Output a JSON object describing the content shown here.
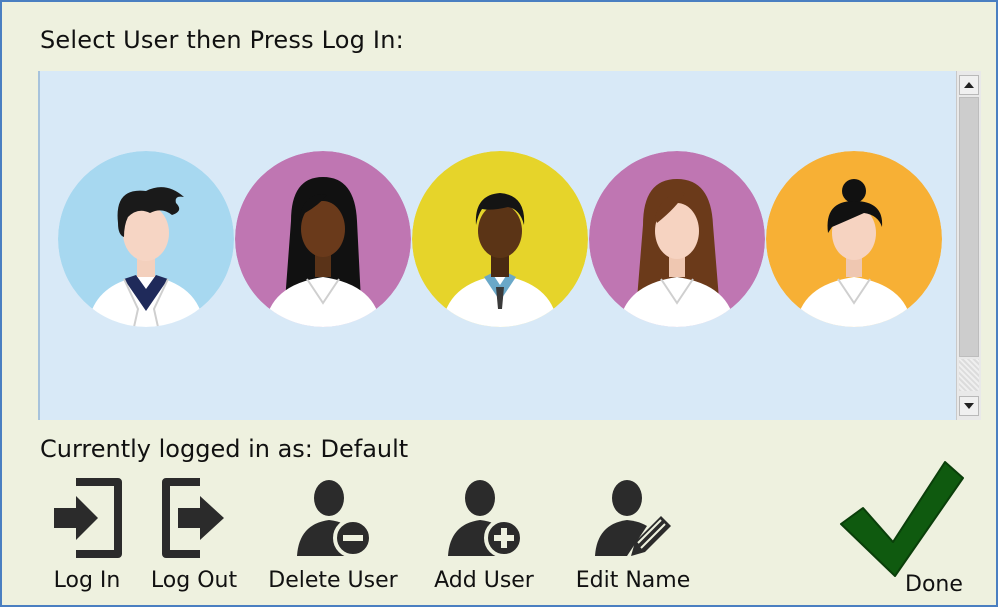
{
  "prompt": "Select User then Press Log In:",
  "status": "Currently logged in as: Default",
  "users": [
    {
      "icon": "male-doctor-avatar",
      "bg": "#a7d8f0"
    },
    {
      "icon": "female-doctor-avatar",
      "bg": "#bf76b2"
    },
    {
      "icon": "male-doctor-avatar",
      "bg": "#e6d42a"
    },
    {
      "icon": "female-doctor-avatar",
      "bg": "#bf76b2"
    },
    {
      "icon": "female-doctor-avatar",
      "bg": "#f7b035"
    }
  ],
  "toolbar": {
    "log_in": "Log In",
    "log_out": "Log Out",
    "delete_user": "Delete User",
    "add_user": "Add User",
    "edit_name": "Edit Name",
    "done": "Done"
  },
  "colors": {
    "window_bg": "#eef1df",
    "list_bg": "#d8e9f7",
    "border": "#4a7fc1",
    "icon_dark": "#2b2b2b",
    "check_green": "#0f5a0f"
  }
}
